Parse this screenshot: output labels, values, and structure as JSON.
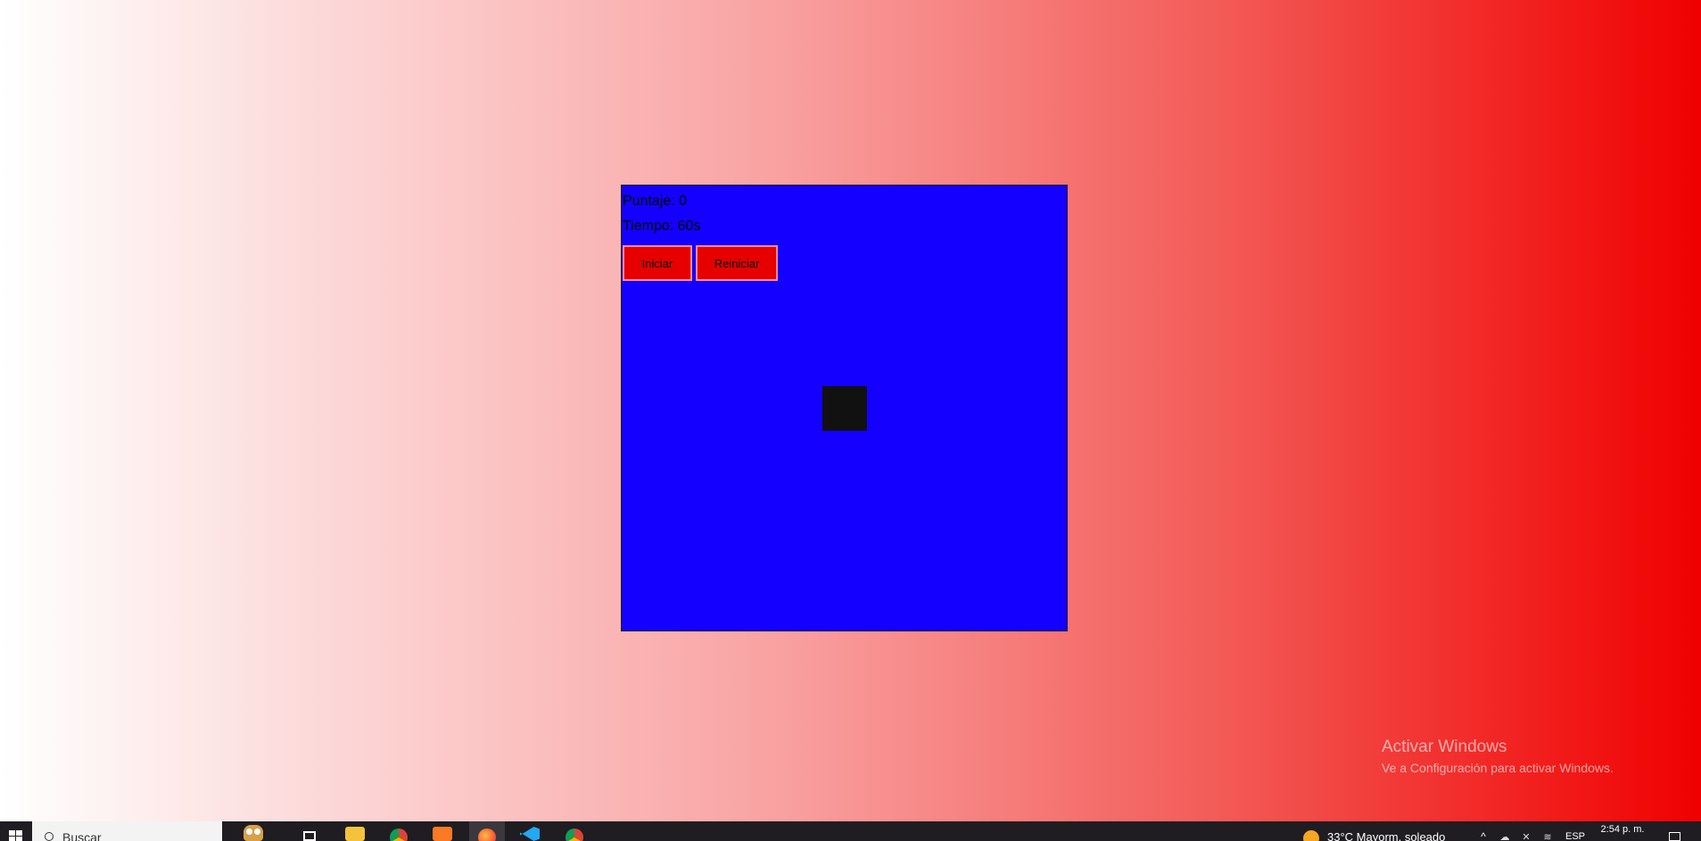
{
  "game": {
    "score_text": "Puntaje: 0",
    "time_text": "Tiempo: 60s",
    "start_label": "Iniciar",
    "restart_label": "Reiniciar",
    "colors": {
      "board": "#1400ff",
      "buttons": "#e60000",
      "target": "#111111",
      "background_gradient": [
        "#ffffff",
        "#f9a3a3",
        "#f35a56",
        "#f00000"
      ]
    }
  },
  "watermark": {
    "title": "Activar Windows",
    "subtitle": "Ve a Configuración para activar Windows."
  },
  "taskbar": {
    "search_placeholder": "Buscar",
    "apps": [
      "windows-start-icon",
      "search-icon",
      "owl-icon",
      "task-view-icon",
      "file-explorer-icon",
      "chrome-icon",
      "xampp-icon",
      "firefox-icon",
      "vscode-icon",
      "chrome-icon"
    ],
    "weather": "33°C  Mayorm. soleado",
    "language": "ESP",
    "clock": "2:54 p. m."
  }
}
